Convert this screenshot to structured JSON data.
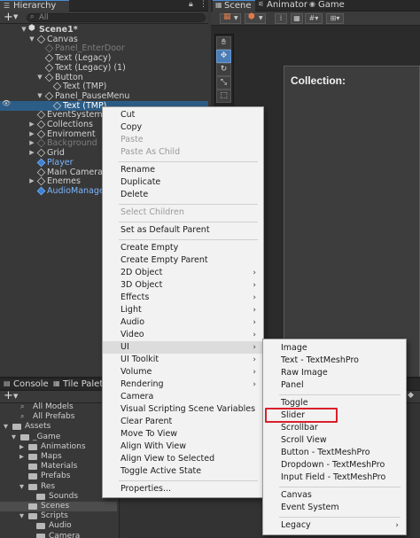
{
  "hierarchy": {
    "tab_label": "Hierarchy",
    "add_label": "+",
    "search_value": "All",
    "tree": [
      {
        "label": "Scene1*",
        "depth": 0,
        "kind": "scene",
        "arrow": "▼",
        "bold": true
      },
      {
        "label": "Canvas",
        "depth": 1,
        "kind": "cube",
        "arrow": "▼"
      },
      {
        "label": "Panel_EnterDoor",
        "depth": 2,
        "kind": "cube",
        "dim": true
      },
      {
        "label": "Text (Legacy)",
        "depth": 2,
        "kind": "cube"
      },
      {
        "label": "Text (Legacy) (1)",
        "depth": 2,
        "kind": "cube"
      },
      {
        "label": "Button",
        "depth": 2,
        "kind": "cube",
        "arrow": "▼"
      },
      {
        "label": "Text (TMP)",
        "depth": 3,
        "kind": "cube"
      },
      {
        "label": "Panel_PauseMenu",
        "depth": 2,
        "kind": "cube",
        "arrow": "▼"
      },
      {
        "label": "Text (TMP)",
        "depth": 3,
        "kind": "cube",
        "selected": true
      },
      {
        "label": "EventSystem",
        "depth": 1,
        "kind": "cube"
      },
      {
        "label": "Collections",
        "depth": 1,
        "kind": "cube",
        "arrow": "▶"
      },
      {
        "label": "Enviroment",
        "depth": 1,
        "kind": "cube",
        "arrow": "▶"
      },
      {
        "label": "Background",
        "depth": 1,
        "kind": "cube",
        "arrow": "▶",
        "dim": true
      },
      {
        "label": "Grid",
        "depth": 1,
        "kind": "cube",
        "arrow": "▶"
      },
      {
        "label": "Player",
        "depth": 1,
        "kind": "prefab"
      },
      {
        "label": "Main Camera",
        "depth": 1,
        "kind": "cube"
      },
      {
        "label": "Enemes",
        "depth": 1,
        "kind": "cube",
        "arrow": "▶"
      },
      {
        "label": "AudioManager",
        "depth": 1,
        "kind": "prefab"
      }
    ]
  },
  "scene_tabs": [
    {
      "label": "Scene",
      "icon": "grid-icon",
      "active": true
    },
    {
      "label": "Animator",
      "icon": "animator-icon"
    },
    {
      "label": "Game",
      "icon": "gamepad-icon"
    }
  ],
  "scene_view": {
    "canvas_title": "Collection:"
  },
  "tools": [
    "hand",
    "move",
    "rotate",
    "scale",
    "rect",
    "transform"
  ],
  "bottom_tabs": [
    {
      "label": "Console",
      "icon": "console-icon"
    },
    {
      "label": "Tile Palette",
      "icon": "palette-icon"
    }
  ],
  "project": {
    "add_label": "+",
    "rows": [
      {
        "label": "All Models",
        "depth": 1,
        "kind": "search"
      },
      {
        "label": "All Prefabs",
        "depth": 1,
        "kind": "search"
      },
      {
        "label": "Assets",
        "depth": 0,
        "kind": "folder",
        "arrow": "▼"
      },
      {
        "label": "_Game",
        "depth": 1,
        "kind": "folder",
        "arrow": "▼"
      },
      {
        "label": "Animations",
        "depth": 2,
        "kind": "folder",
        "arrow": "▶"
      },
      {
        "label": "Maps",
        "depth": 2,
        "kind": "folder",
        "arrow": "▶"
      },
      {
        "label": "Materials",
        "depth": 2,
        "kind": "folder"
      },
      {
        "label": "Prefabs",
        "depth": 2,
        "kind": "folder"
      },
      {
        "label": "Res",
        "depth": 2,
        "kind": "folder",
        "arrow": "▼"
      },
      {
        "label": "Sounds",
        "depth": 3,
        "kind": "folder"
      },
      {
        "label": "Scenes",
        "depth": 2,
        "kind": "folder",
        "selected": true
      },
      {
        "label": "Scripts",
        "depth": 2,
        "kind": "folder",
        "arrow": "▼"
      },
      {
        "label": "Audio",
        "depth": 3,
        "kind": "folder"
      },
      {
        "label": "Camera",
        "depth": 3,
        "kind": "folder"
      }
    ]
  },
  "context_menu": {
    "items": [
      {
        "label": "Cut"
      },
      {
        "label": "Copy"
      },
      {
        "label": "Paste",
        "disabled": true
      },
      {
        "label": "Paste As Child",
        "disabled": true
      },
      {
        "sep": true
      },
      {
        "label": "Rename"
      },
      {
        "label": "Duplicate"
      },
      {
        "label": "Delete"
      },
      {
        "sep": true
      },
      {
        "label": "Select Children",
        "disabled": true
      },
      {
        "sep": true
      },
      {
        "label": "Set as Default Parent"
      },
      {
        "sep": true
      },
      {
        "label": "Create Empty"
      },
      {
        "label": "Create Empty Parent"
      },
      {
        "label": "2D Object",
        "submenu": true
      },
      {
        "label": "3D Object",
        "submenu": true
      },
      {
        "label": "Effects",
        "submenu": true
      },
      {
        "label": "Light",
        "submenu": true
      },
      {
        "label": "Audio",
        "submenu": true
      },
      {
        "label": "Video",
        "submenu": true
      },
      {
        "label": "UI",
        "submenu": true,
        "highlighted": true
      },
      {
        "label": "UI Toolkit",
        "submenu": true
      },
      {
        "label": "Volume",
        "submenu": true
      },
      {
        "label": "Rendering",
        "submenu": true
      },
      {
        "label": "Camera"
      },
      {
        "label": "Visual Scripting Scene Variables"
      },
      {
        "label": "Clear Parent"
      },
      {
        "label": "Move To View"
      },
      {
        "label": "Align With View"
      },
      {
        "label": "Align View to Selected"
      },
      {
        "label": "Toggle Active State"
      },
      {
        "sep": true
      },
      {
        "label": "Properties..."
      }
    ]
  },
  "ui_submenu": {
    "items": [
      {
        "label": "Image"
      },
      {
        "label": "Text - TextMeshPro"
      },
      {
        "label": "Raw Image"
      },
      {
        "label": "Panel"
      },
      {
        "sep": true
      },
      {
        "label": "Toggle"
      },
      {
        "label": "Slider",
        "highlighted": true
      },
      {
        "label": "Scrollbar"
      },
      {
        "label": "Scroll View"
      },
      {
        "label": "Button - TextMeshPro"
      },
      {
        "label": "Dropdown - TextMeshPro"
      },
      {
        "label": "Input Field - TextMeshPro"
      },
      {
        "sep": true
      },
      {
        "label": "Canvas"
      },
      {
        "label": "Event System"
      },
      {
        "sep": true
      },
      {
        "label": "Legacy",
        "submenu": true
      }
    ]
  },
  "colors": {
    "selection": "#2c5d87",
    "prefab_blue": "#7bb6ff",
    "highlight_box": "#d9202a"
  }
}
